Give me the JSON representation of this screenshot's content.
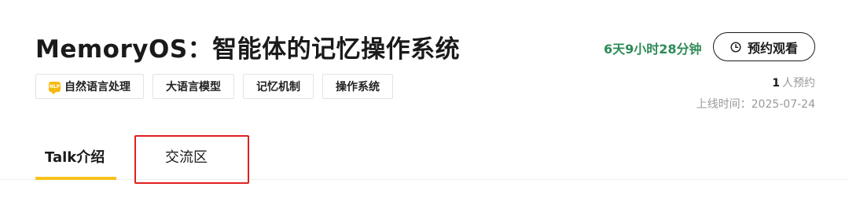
{
  "header": {
    "title": "MemoryOS：智能体的记忆操作系统"
  },
  "tags": [
    {
      "label": "自然语言处理",
      "icon": "nlp-chat-icon",
      "icon_text": "NLP"
    },
    {
      "label": "大语言模型"
    },
    {
      "label": "记忆机制"
    },
    {
      "label": "操作系统"
    }
  ],
  "countdown": "6天9小时28分钟",
  "reserve_button": {
    "label": "预约观看",
    "icon": "clock-icon"
  },
  "reservation": {
    "count": "1",
    "suffix": "人预约"
  },
  "release": {
    "label": "上线时间：",
    "date": "2025-07-24"
  },
  "tabs": [
    {
      "label": "Talk介绍",
      "active": true
    },
    {
      "label": "交流区",
      "active": false
    }
  ],
  "colors": {
    "accent_yellow": "#f6c21c",
    "countdown_green": "#2e8b57",
    "highlight_red": "#e02020"
  }
}
